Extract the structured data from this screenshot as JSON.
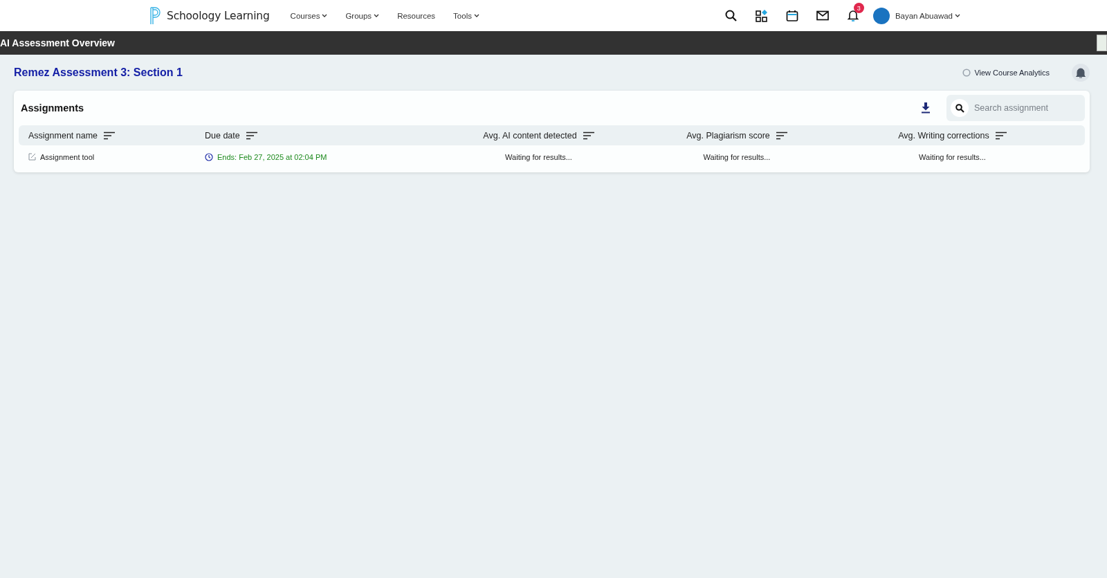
{
  "top_nav": {
    "brand": "Schoology Learning",
    "menu": [
      {
        "label": "Courses",
        "dropdown": true
      },
      {
        "label": "Groups",
        "dropdown": true
      },
      {
        "label": "Resources",
        "dropdown": false
      },
      {
        "label": "Tools",
        "dropdown": true
      }
    ],
    "notification_count": "3",
    "user_name": "Bayan Abuawad"
  },
  "page_bar": {
    "title": "AI Assessment Overview"
  },
  "course": {
    "title": "Remez Assessment 3: Section 1",
    "analytics_link": "View Course Analytics"
  },
  "assignments": {
    "title": "Assignments",
    "search": {
      "placeholder": "Search assignment"
    },
    "columns": [
      "Assignment name",
      "Due date",
      "Avg. AI content detected",
      "Avg. Plagiarism score",
      "Avg. Writing corrections"
    ],
    "rows": [
      {
        "name": "Assignment tool",
        "due": "Ends: Feb 27, 2025 at 02:04 PM",
        "ai": "Waiting for results...",
        "plagiarism": "Waiting for results...",
        "writing": "Waiting for results..."
      }
    ]
  }
}
